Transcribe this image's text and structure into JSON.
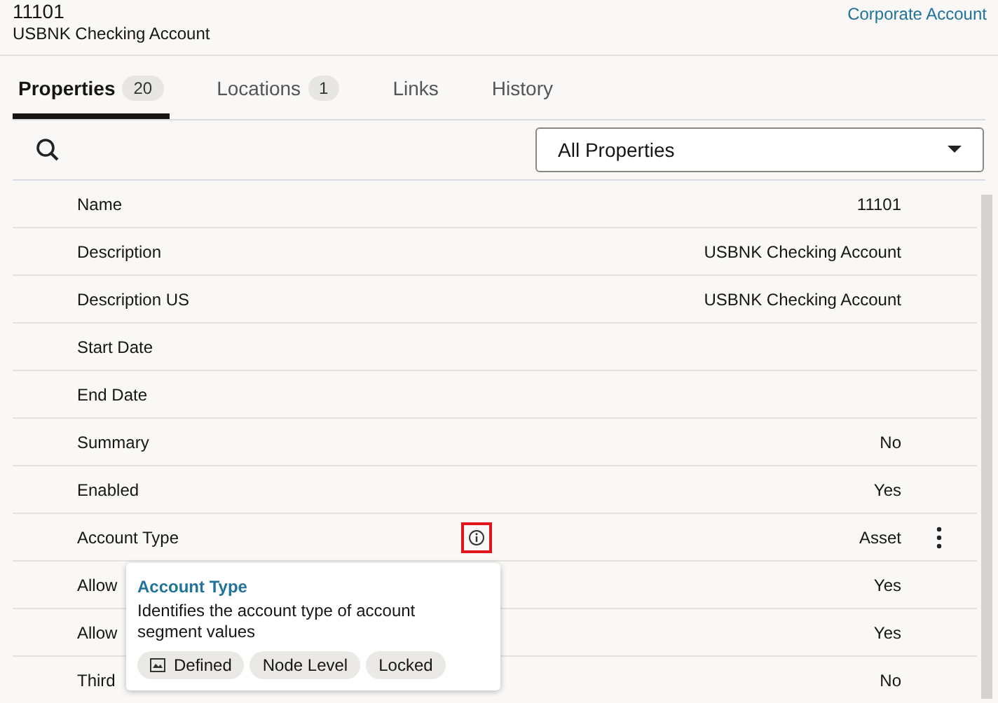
{
  "header": {
    "code": "11101",
    "name": "USBNK Checking Account",
    "link": "Corporate Account"
  },
  "tabs": [
    {
      "label": "Properties",
      "count": "20",
      "selected": true
    },
    {
      "label": "Locations",
      "count": "1",
      "selected": false
    },
    {
      "label": "Links",
      "selected": false
    },
    {
      "label": "History",
      "selected": false
    }
  ],
  "filter": {
    "value": "All Properties"
  },
  "rows": [
    {
      "label": "Name",
      "value": "11101"
    },
    {
      "label": "Description",
      "value": "USBNK Checking Account"
    },
    {
      "label": "Description US",
      "value": "USBNK Checking Account"
    },
    {
      "label": "Start Date"
    },
    {
      "label": "End Date"
    },
    {
      "label": "Summary",
      "value": "No"
    },
    {
      "label": "Enabled",
      "value": "Yes"
    },
    {
      "label": "Account Type",
      "value": "Asset",
      "info": true,
      "info_highlighted": true,
      "menu": true
    },
    {
      "label": "Allow",
      "value": "Yes"
    },
    {
      "label": "Allow",
      "value": "Yes"
    },
    {
      "label": "Third",
      "value": "No"
    }
  ],
  "popover": {
    "title": "Account Type",
    "description": "Identifies the account type of account segment values",
    "chips": [
      {
        "label": "Defined",
        "kind": "icon"
      },
      {
        "label": "Node Level",
        "kind": "plain"
      },
      {
        "label": "Locked",
        "kind": "plain"
      }
    ]
  }
}
